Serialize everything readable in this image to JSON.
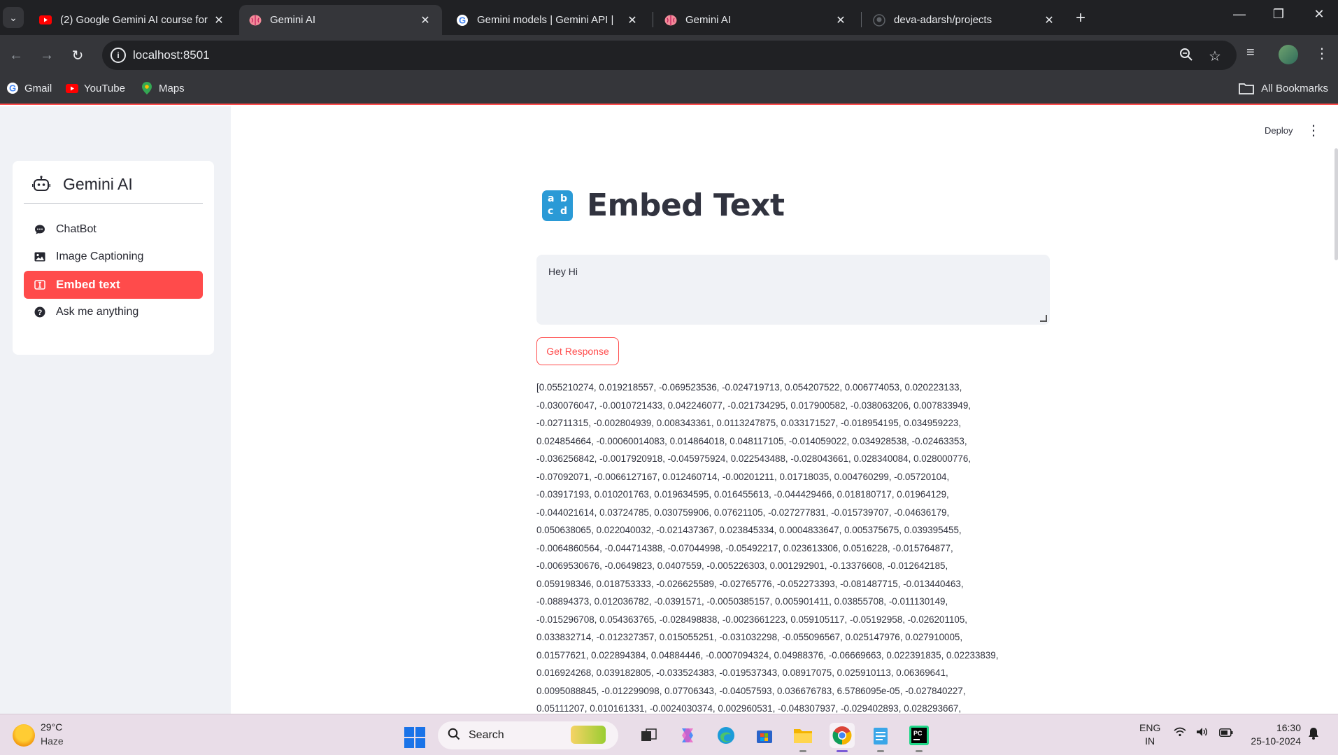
{
  "browser": {
    "tabs": [
      {
        "title": "(2) Google Gemini AI course for",
        "favicon": "youtube-icon",
        "active": false
      },
      {
        "title": "Gemini AI",
        "favicon": "brain-icon",
        "active": true
      },
      {
        "title": "Gemini models  |  Gemini API  |",
        "favicon": "google-icon",
        "active": false
      },
      {
        "title": "Gemini AI",
        "favicon": "brain-icon",
        "active": false
      },
      {
        "title": "deva-adarsh/projects",
        "favicon": "github-icon",
        "active": false
      }
    ],
    "url": "localhost:8501",
    "bookmarks": [
      {
        "label": "Gmail",
        "icon": "google-icon"
      },
      {
        "label": "YouTube",
        "icon": "youtube-icon"
      },
      {
        "label": "Maps",
        "icon": "maps-icon"
      }
    ],
    "all_bookmarks_label": "All Bookmarks"
  },
  "app": {
    "sidebar_title": "Gemini AI",
    "menu": [
      {
        "label": "ChatBot",
        "icon": "chat-bubble-icon",
        "active": false
      },
      {
        "label": "Image Captioning",
        "icon": "image-icon",
        "active": false
      },
      {
        "label": "Embed text",
        "icon": "textbox-icon",
        "active": true
      },
      {
        "label": "Ask me anything",
        "icon": "question-icon",
        "active": false
      }
    ],
    "deploy_label": "Deploy",
    "page_title": "Embed Text",
    "input_value": "Hey Hi",
    "button_label": "Get Response",
    "embedding_lines": [
      "[0.055210274, 0.019218557, -0.069523536, -0.024719713, 0.054207522, 0.006774053, 0.020223133,",
      "-0.030076047, -0.0010721433, 0.042246077, -0.021734295, 0.017900582, -0.038063206, 0.007833949,",
      "-0.02711315, -0.002804939, 0.008343361, 0.0113247875, 0.033171527, -0.018954195, 0.034959223,",
      "0.024854664, -0.00060014083, 0.014864018, 0.048117105, -0.014059022, 0.034928538, -0.02463353,",
      "-0.036256842, -0.0017920918, -0.045975924, 0.022543488, -0.028043661, 0.028340084, 0.028000776,",
      "-0.07092071, -0.0066127167, 0.012460714, -0.00201211, 0.01718035, 0.004760299, -0.05720104,",
      "-0.03917193, 0.010201763, 0.019634595, 0.016455613, -0.044429466, 0.018180717, 0.01964129,",
      "-0.044021614, 0.03724785, 0.030759906, 0.07621105, -0.027277831, -0.015739707, -0.04636179,",
      "0.050638065, 0.022040032, -0.021437367, 0.023845334, 0.0004833647, 0.005375675, 0.039395455,",
      "-0.0064860564, -0.044714388, -0.07044998, -0.05492217, 0.023613306, 0.0516228, -0.015764877,",
      "-0.0069530676, -0.0649823, 0.0407559, -0.005226303, 0.001292901, -0.13376608, -0.012642185,",
      "0.059198346, 0.018753333, -0.026625589, -0.02765776, -0.052273393, -0.081487715, -0.013440463,",
      "-0.08894373, 0.012036782, -0.0391571, -0.0050385157, 0.005901411, 0.03855708, -0.011130149,",
      "-0.015296708, 0.054363765, -0.028498838, -0.0023661223, 0.059105117, -0.05192958, -0.026201105,",
      "0.033832714, -0.012327357, 0.015055251, -0.031032298, -0.055096567, 0.025147976, 0.027910005,",
      "0.01577621, 0.022894384, 0.04884446, -0.0007094324, 0.04988376, -0.06669663, 0.022391835, 0.02233839,",
      "0.016924268, 0.039182805, -0.033524383, -0.019537343, 0.08917075, 0.025910113, 0.06369641,",
      "0.0095088845, -0.012299098, 0.07706343, -0.04057593, 0.036676783, 6.5786095e-05, -0.027840227,",
      "0.05111207, 0.010161331, -0.0024030374, 0.002960531, -0.048307937, -0.029402893, 0.028293667,"
    ]
  },
  "taskbar": {
    "temperature": "29°C",
    "condition": "Haze",
    "search_placeholder": "Search",
    "lang_line1": "ENG",
    "lang_line2": "IN",
    "time": "16:30",
    "date": "25-10-2024"
  }
}
